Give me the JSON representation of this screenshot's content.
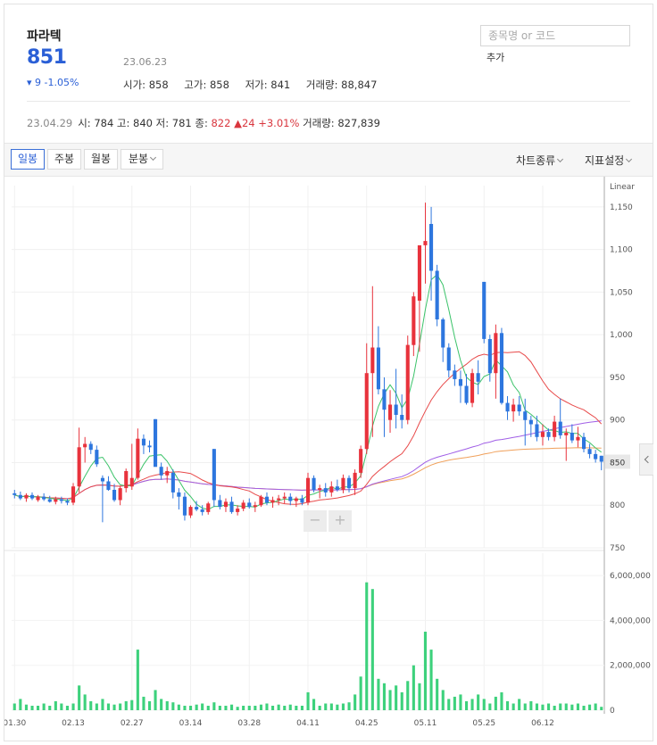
{
  "stock": {
    "name": "파라텍",
    "price": "851",
    "change": "▾ 9 -1.05%",
    "date": "23.06.23",
    "ohlc": [
      "시가: 858",
      "고가: 858",
      "저가: 841",
      "거래량: 88,847"
    ]
  },
  "search": {
    "placeholder": "종목명 or 코드",
    "add_label": "추가"
  },
  "previous": {
    "date": "23.04.29",
    "text": "시: 784   고: 840   저: 781   종:",
    "close": "822",
    "change": "▲24 +3.01%",
    "volume": "거래량: 827,839"
  },
  "toolbar": {
    "tabs": [
      "일봉",
      "주봉",
      "월봉",
      "분봉"
    ],
    "active": 0,
    "chart_type": "차트종류",
    "indicators": "지표설정"
  },
  "colors": {
    "up": "#e8323c",
    "down": "#2d76de",
    "ma5": "#3cc36a",
    "ma20": "#e84a4a",
    "ma60": "#a05ee6",
    "ma120": "#f0a05a",
    "volume": "#3dd17c"
  },
  "chart_data": {
    "type": "candlestick",
    "scale_label": "Linear",
    "ylim": [
      750,
      1175
    ],
    "y_ticks": [
      750,
      800,
      850,
      900,
      950,
      "1,000",
      "1,050",
      "1,100",
      "1,150"
    ],
    "current_price_tag": "850",
    "x_labels": [
      "01.30",
      "02.13",
      "02.27",
      "03.14",
      "03.28",
      "04.11",
      "04.25",
      "05.11",
      "05.25",
      "06.12"
    ],
    "x_label_index": [
      0,
      10,
      20,
      30,
      40,
      50,
      60,
      70,
      80,
      90
    ],
    "volume_ylim": [
      0,
      7000000
    ],
    "volume_ticks": [
      "0",
      "2,000,000",
      "4,000,000",
      "6,000,000"
    ],
    "candles": [
      {
        "o": 814,
        "h": 818,
        "l": 808,
        "c": 812
      },
      {
        "o": 812,
        "h": 816,
        "l": 806,
        "c": 808
      },
      {
        "o": 808,
        "h": 814,
        "l": 804,
        "c": 812
      },
      {
        "o": 812,
        "h": 815,
        "l": 806,
        "c": 808
      },
      {
        "o": 806,
        "h": 812,
        "l": 804,
        "c": 810
      },
      {
        "o": 810,
        "h": 814,
        "l": 805,
        "c": 807
      },
      {
        "o": 807,
        "h": 811,
        "l": 803,
        "c": 804
      },
      {
        "o": 804,
        "h": 810,
        "l": 801,
        "c": 807
      },
      {
        "o": 807,
        "h": 810,
        "l": 802,
        "c": 805
      },
      {
        "o": 805,
        "h": 808,
        "l": 800,
        "c": 803
      },
      {
        "o": 803,
        "h": 826,
        "l": 800,
        "c": 822
      },
      {
        "o": 822,
        "h": 891,
        "l": 815,
        "c": 868
      },
      {
        "o": 868,
        "h": 880,
        "l": 850,
        "c": 872
      },
      {
        "o": 872,
        "h": 875,
        "l": 860,
        "c": 865
      },
      {
        "o": 865,
        "h": 870,
        "l": 845,
        "c": 848
      },
      {
        "o": 832,
        "h": 835,
        "l": 780,
        "c": 828
      },
      {
        "o": 828,
        "h": 834,
        "l": 817,
        "c": 818
      },
      {
        "o": 818,
        "h": 825,
        "l": 804,
        "c": 806
      },
      {
        "o": 806,
        "h": 823,
        "l": 800,
        "c": 820
      },
      {
        "o": 820,
        "h": 843,
        "l": 815,
        "c": 840
      },
      {
        "o": 822,
        "h": 872,
        "l": 818,
        "c": 832
      },
      {
        "o": 832,
        "h": 890,
        "l": 830,
        "c": 878
      },
      {
        "o": 878,
        "h": 883,
        "l": 860,
        "c": 870
      },
      {
        "o": 870,
        "h": 876,
        "l": 862,
        "c": 868
      },
      {
        "o": 901,
        "h": 901,
        "l": 858,
        "c": 845
      },
      {
        "o": 845,
        "h": 850,
        "l": 830,
        "c": 835
      },
      {
        "o": 835,
        "h": 845,
        "l": 826,
        "c": 840
      },
      {
        "o": 838,
        "h": 842,
        "l": 808,
        "c": 815
      },
      {
        "o": 815,
        "h": 820,
        "l": 795,
        "c": 810
      },
      {
        "o": 810,
        "h": 815,
        "l": 782,
        "c": 788
      },
      {
        "o": 788,
        "h": 800,
        "l": 785,
        "c": 798
      },
      {
        "o": 798,
        "h": 805,
        "l": 793,
        "c": 795
      },
      {
        "o": 795,
        "h": 800,
        "l": 788,
        "c": 792
      },
      {
        "o": 792,
        "h": 804,
        "l": 789,
        "c": 802
      },
      {
        "o": 866,
        "h": 866,
        "l": 798,
        "c": 806
      },
      {
        "o": 806,
        "h": 812,
        "l": 795,
        "c": 798
      },
      {
        "o": 798,
        "h": 808,
        "l": 792,
        "c": 804
      },
      {
        "o": 804,
        "h": 810,
        "l": 790,
        "c": 792
      },
      {
        "o": 792,
        "h": 800,
        "l": 788,
        "c": 796
      },
      {
        "o": 796,
        "h": 806,
        "l": 793,
        "c": 803
      },
      {
        "o": 803,
        "h": 808,
        "l": 796,
        "c": 798
      },
      {
        "o": 798,
        "h": 804,
        "l": 792,
        "c": 800
      },
      {
        "o": 800,
        "h": 812,
        "l": 798,
        "c": 810
      },
      {
        "o": 810,
        "h": 815,
        "l": 800,
        "c": 803
      },
      {
        "o": 803,
        "h": 810,
        "l": 797,
        "c": 806
      },
      {
        "o": 806,
        "h": 812,
        "l": 800,
        "c": 808
      },
      {
        "o": 808,
        "h": 815,
        "l": 802,
        "c": 810
      },
      {
        "o": 810,
        "h": 814,
        "l": 800,
        "c": 805
      },
      {
        "o": 805,
        "h": 810,
        "l": 798,
        "c": 808
      },
      {
        "o": 808,
        "h": 812,
        "l": 800,
        "c": 803
      },
      {
        "o": 803,
        "h": 838,
        "l": 800,
        "c": 832
      },
      {
        "o": 832,
        "h": 835,
        "l": 815,
        "c": 818
      },
      {
        "o": 818,
        "h": 824,
        "l": 808,
        "c": 820
      },
      {
        "o": 820,
        "h": 826,
        "l": 810,
        "c": 815
      },
      {
        "o": 815,
        "h": 828,
        "l": 810,
        "c": 822
      },
      {
        "o": 822,
        "h": 830,
        "l": 816,
        "c": 818
      },
      {
        "o": 818,
        "h": 836,
        "l": 814,
        "c": 832
      },
      {
        "o": 832,
        "h": 835,
        "l": 815,
        "c": 820
      },
      {
        "o": 820,
        "h": 842,
        "l": 812,
        "c": 838
      },
      {
        "o": 838,
        "h": 870,
        "l": 832,
        "c": 866
      },
      {
        "o": 866,
        "h": 990,
        "l": 860,
        "c": 955
      },
      {
        "o": 955,
        "h": 1057,
        "l": 880,
        "c": 985
      },
      {
        "o": 985,
        "h": 1010,
        "l": 930,
        "c": 936
      },
      {
        "o": 936,
        "h": 950,
        "l": 880,
        "c": 912
      },
      {
        "o": 900,
        "h": 935,
        "l": 885,
        "c": 918
      },
      {
        "o": 918,
        "h": 960,
        "l": 890,
        "c": 906
      },
      {
        "o": 906,
        "h": 930,
        "l": 890,
        "c": 900
      },
      {
        "o": 900,
        "h": 999,
        "l": 895,
        "c": 988
      },
      {
        "o": 988,
        "h": 1050,
        "l": 975,
        "c": 1045
      },
      {
        "o": 1040,
        "h": 1080,
        "l": 980,
        "c": 1105
      },
      {
        "o": 1105,
        "h": 1155,
        "l": 1060,
        "c": 1110
      },
      {
        "o": 1130,
        "h": 1150,
        "l": 1040,
        "c": 1075
      },
      {
        "o": 1075,
        "h": 1082,
        "l": 1010,
        "c": 1018
      },
      {
        "o": 1018,
        "h": 1020,
        "l": 968,
        "c": 985
      },
      {
        "o": 985,
        "h": 990,
        "l": 950,
        "c": 958
      },
      {
        "o": 958,
        "h": 965,
        "l": 940,
        "c": 948
      },
      {
        "o": 948,
        "h": 958,
        "l": 920,
        "c": 940
      },
      {
        "o": 940,
        "h": 954,
        "l": 918,
        "c": 920
      },
      {
        "o": 920,
        "h": 960,
        "l": 915,
        "c": 955
      },
      {
        "o": 955,
        "h": 970,
        "l": 930,
        "c": 945
      },
      {
        "o": 1062,
        "h": 1062,
        "l": 990,
        "c": 995
      },
      {
        "o": 995,
        "h": 1000,
        "l": 945,
        "c": 955
      },
      {
        "o": 955,
        "h": 1012,
        "l": 925,
        "c": 1002
      },
      {
        "o": 1002,
        "h": 1008,
        "l": 918,
        "c": 920
      },
      {
        "o": 920,
        "h": 928,
        "l": 900,
        "c": 910
      },
      {
        "o": 910,
        "h": 925,
        "l": 898,
        "c": 918
      },
      {
        "o": 918,
        "h": 928,
        "l": 905,
        "c": 910
      },
      {
        "o": 910,
        "h": 925,
        "l": 870,
        "c": 900
      },
      {
        "o": 900,
        "h": 905,
        "l": 880,
        "c": 895
      },
      {
        "o": 895,
        "h": 905,
        "l": 875,
        "c": 880
      },
      {
        "o": 880,
        "h": 895,
        "l": 870,
        "c": 886
      },
      {
        "o": 886,
        "h": 890,
        "l": 876,
        "c": 880
      },
      {
        "o": 880,
        "h": 905,
        "l": 875,
        "c": 898
      },
      {
        "o": 898,
        "h": 925,
        "l": 878,
        "c": 882
      },
      {
        "o": 882,
        "h": 890,
        "l": 852,
        "c": 885
      },
      {
        "o": 885,
        "h": 895,
        "l": 873,
        "c": 876
      },
      {
        "o": 876,
        "h": 892,
        "l": 868,
        "c": 880
      },
      {
        "o": 880,
        "h": 885,
        "l": 862,
        "c": 866
      },
      {
        "o": 866,
        "h": 872,
        "l": 855,
        "c": 860
      },
      {
        "o": 860,
        "h": 865,
        "l": 850,
        "c": 854
      },
      {
        "o": 858,
        "h": 858,
        "l": 841,
        "c": 851
      }
    ],
    "volume": [
      0.3,
      0.5,
      0.25,
      0.2,
      0.2,
      0.3,
      0.2,
      0.4,
      0.3,
      0.2,
      0.3,
      1.1,
      0.7,
      0.4,
      0.3,
      0.5,
      0.3,
      0.25,
      0.3,
      0.4,
      0.45,
      2.7,
      0.6,
      0.4,
      0.9,
      0.5,
      0.4,
      0.35,
      0.25,
      0.2,
      0.2,
      0.25,
      0.3,
      0.2,
      0.35,
      0.2,
      0.2,
      0.25,
      0.15,
      0.2,
      0.2,
      0.2,
      0.25,
      0.3,
      0.2,
      0.25,
      0.2,
      0.25,
      0.2,
      0.2,
      0.8,
      0.5,
      0.2,
      0.3,
      0.3,
      0.25,
      0.3,
      0.35,
      0.7,
      1.5,
      5.7,
      5.4,
      1.4,
      1.2,
      0.9,
      1.1,
      0.8,
      1.3,
      2.0,
      1.2,
      3.5,
      2.7,
      1.4,
      0.9,
      0.5,
      0.6,
      0.7,
      0.4,
      0.5,
      0.7,
      0.5,
      0.3,
      0.6,
      0.8,
      0.4,
      0.3,
      0.5,
      0.3,
      0.4,
      0.3,
      0.25,
      0.3,
      0.2,
      0.3,
      0.3,
      0.25,
      0.3,
      0.2,
      0.25,
      0.3,
      0.15
    ]
  }
}
